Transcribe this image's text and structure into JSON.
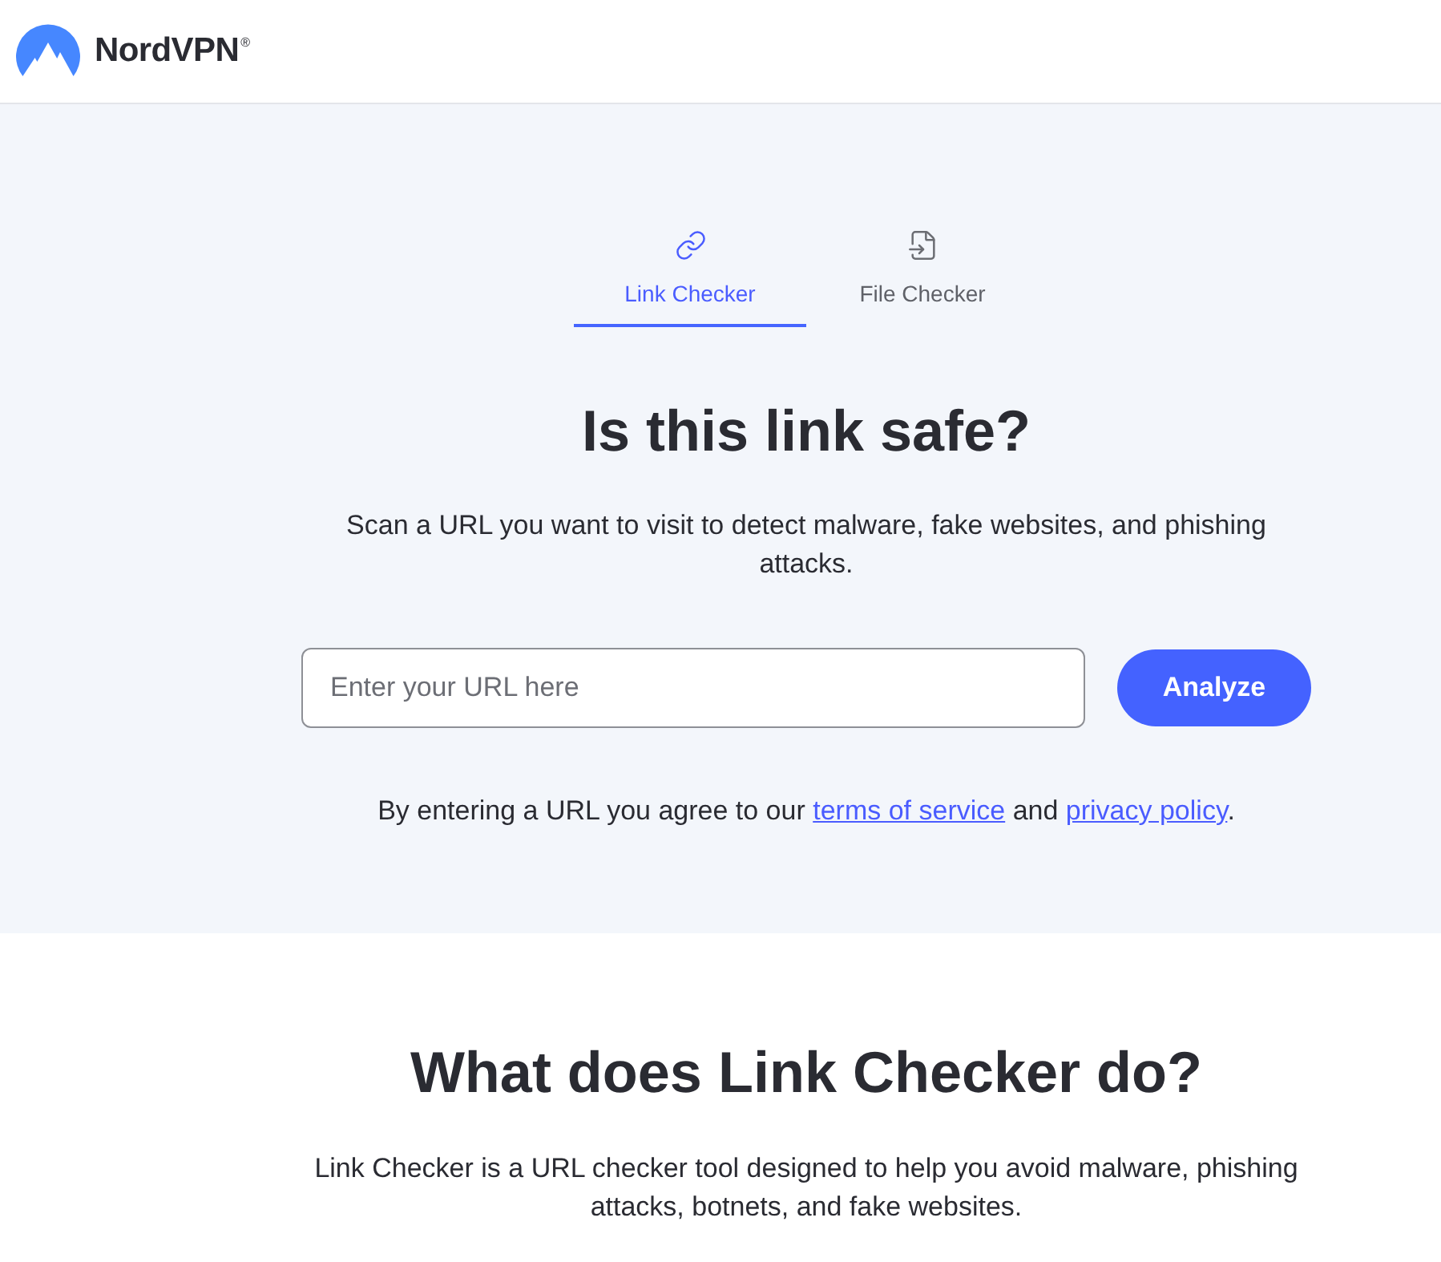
{
  "header": {
    "brand": "NordVPN$^{®}$"
  },
  "tabs": [
    {
      "kind": "link",
      "label": "Link Checker",
      "selected": true
    },
    {
      "kind": "file",
      "label": "File Checker",
      "selected": false
    }
  ],
  "hero": {
    "title": "Is this link safe?",
    "subtitle": "Scan a URL you want to visit to detect malware, fake websites, and phishing attacks.",
    "url_field": {
      "placeholder": "Enter your URL here"
    },
    "analyze_button": "Analyze",
    "consent": [
      {
        "kind": "text",
        "text": "By entering a URL you agree to our "
      },
      {
        "kind": "link",
        "text": "terms of service"
      },
      {
        "kind": "text",
        "text": " and "
      },
      {
        "kind": "link",
        "text": "privacy policy"
      },
      {
        "kind": "text",
        "text": "."
      }
    ]
  },
  "about": {
    "title": "What does Link Checker do?",
    "text": "Link Checker is a URL checker tool designed to help you avoid malware, phishing attacks, botnets, and fake websites."
  }
}
